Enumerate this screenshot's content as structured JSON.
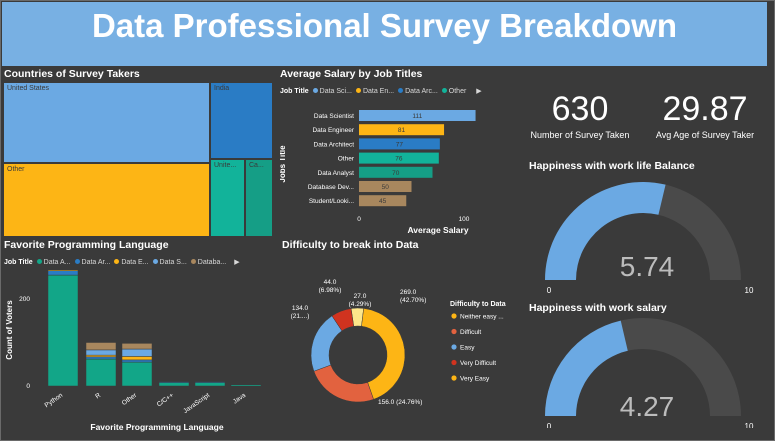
{
  "dashboard_title": "Data Professional Survey Breakdown",
  "treemap": {
    "title": "Countries of Survey Takers",
    "tiles": [
      {
        "label": "United States",
        "color": "#6ba9e3"
      },
      {
        "label": "Other",
        "color": "#fdb515"
      },
      {
        "label": "India",
        "color": "#2a7cc5"
      },
      {
        "label": "Unite...",
        "color": "#12b39a"
      },
      {
        "label": "Ca...",
        "color": "#159e86"
      }
    ]
  },
  "salary": {
    "title": "Average Salary by Job Titles",
    "legend_label": "Job Title",
    "legend": [
      {
        "name": "Data Sci...",
        "color": "#6ba9e3"
      },
      {
        "name": "Data En...",
        "color": "#fdb515"
      },
      {
        "name": "Data Arc...",
        "color": "#2a7cc5"
      },
      {
        "name": "Other",
        "color": "#12b39a"
      }
    ],
    "y_axis_title": "Jobs Title",
    "x_axis_title": "Average Salary"
  },
  "kpis": {
    "count_value": "630",
    "count_label": "Number of Survey Taken",
    "age_value": "29.87",
    "age_label": "Avg Age of Survey Taker"
  },
  "gauge_balance": {
    "title": "Happiness with work life Balance",
    "value": 5.74,
    "value_text": "5.74",
    "min": "0",
    "max": "10"
  },
  "gauge_salary": {
    "title": "Happiness with work salary",
    "value": 4.27,
    "value_text": "4.27",
    "min": "0",
    "max": "10"
  },
  "languages": {
    "title": "Favorite Programming Language",
    "legend_label": "Job Title",
    "legend": [
      {
        "name": "Data A...",
        "color": "#12a688"
      },
      {
        "name": "Data Ar...",
        "color": "#2a7cc5"
      },
      {
        "name": "Data E...",
        "color": "#fdb515"
      },
      {
        "name": "Data S...",
        "color": "#6ba9e3"
      },
      {
        "name": "Databa...",
        "color": "#a8875e"
      }
    ],
    "y_axis_title": "Count of Voters",
    "x_axis_title": "Favorite Programming Language"
  },
  "difficulty": {
    "title": "Difficulty to break into Data",
    "legend_title": "Difficulty to Data",
    "labels": [
      {
        "text1": "44.0",
        "text2": "(6.98%)"
      },
      {
        "text1": "27.0",
        "text2": "(4.29%)"
      },
      {
        "text1": "269.0",
        "text2": "(42.70%)"
      },
      {
        "text1": "134.0",
        "text2": "(21....)"
      },
      {
        "text1": "156.0 (24.76%)",
        "text2": ""
      }
    ]
  },
  "chart_data": [
    {
      "type": "bar",
      "orientation": "horizontal",
      "title": "Average Salary by Job Titles",
      "xlabel": "Average Salary",
      "ylabel": "Jobs Title",
      "xlim": [
        0,
        100
      ],
      "x_ticks": [
        "0",
        "100"
      ],
      "categories": [
        "Data Scientist",
        "Data Engineer",
        "Data Architect",
        "Other",
        "Data Analyst",
        "Database Dev...",
        "Student/Looki..."
      ],
      "values": [
        111,
        81,
        77,
        76,
        70,
        50,
        45
      ],
      "colors": [
        "#6ba9e3",
        "#fdb515",
        "#2a7cc5",
        "#12b39a",
        "#159e86",
        "#a8875e",
        "#a8875e"
      ]
    },
    {
      "type": "bar",
      "stacked": true,
      "title": "Favorite Programming Language",
      "xlabel": "Favorite Programming Language",
      "ylabel": "Count of Voters",
      "ylim": [
        0,
        450
      ],
      "y_ticks": [
        "0",
        "200",
        "400"
      ],
      "categories": [
        "Python",
        "R",
        "Other",
        "C/C++",
        "JavaScript",
        "Java"
      ],
      "series": [
        {
          "name": "Data A...",
          "values": [
            255,
            62,
            55,
            8,
            8,
            3
          ]
        },
        {
          "name": "Data Ar...",
          "values": [
            10,
            5,
            5,
            2,
            2,
            1
          ]
        },
        {
          "name": "Data E...",
          "values": [
            30,
            4,
            8,
            0,
            0,
            0
          ]
        },
        {
          "name": "Data S...",
          "values": [
            20,
            12,
            17,
            0,
            0,
            0
          ]
        },
        {
          "name": "Databa...",
          "values": [
            60,
            17,
            13,
            0,
            0,
            0
          ]
        }
      ]
    },
    {
      "type": "pie",
      "donut": true,
      "title": "Difficulty to break into Data",
      "categories": [
        "Neither easy ...",
        "Difficult",
        "Easy",
        "Very Difficult",
        "Very Easy"
      ],
      "values": [
        269,
        156,
        134,
        44,
        27
      ],
      "colors": [
        "#fdb515",
        "#e2623f",
        "#6ba9e3",
        "#d0331f",
        "#fdb515"
      ]
    }
  ]
}
